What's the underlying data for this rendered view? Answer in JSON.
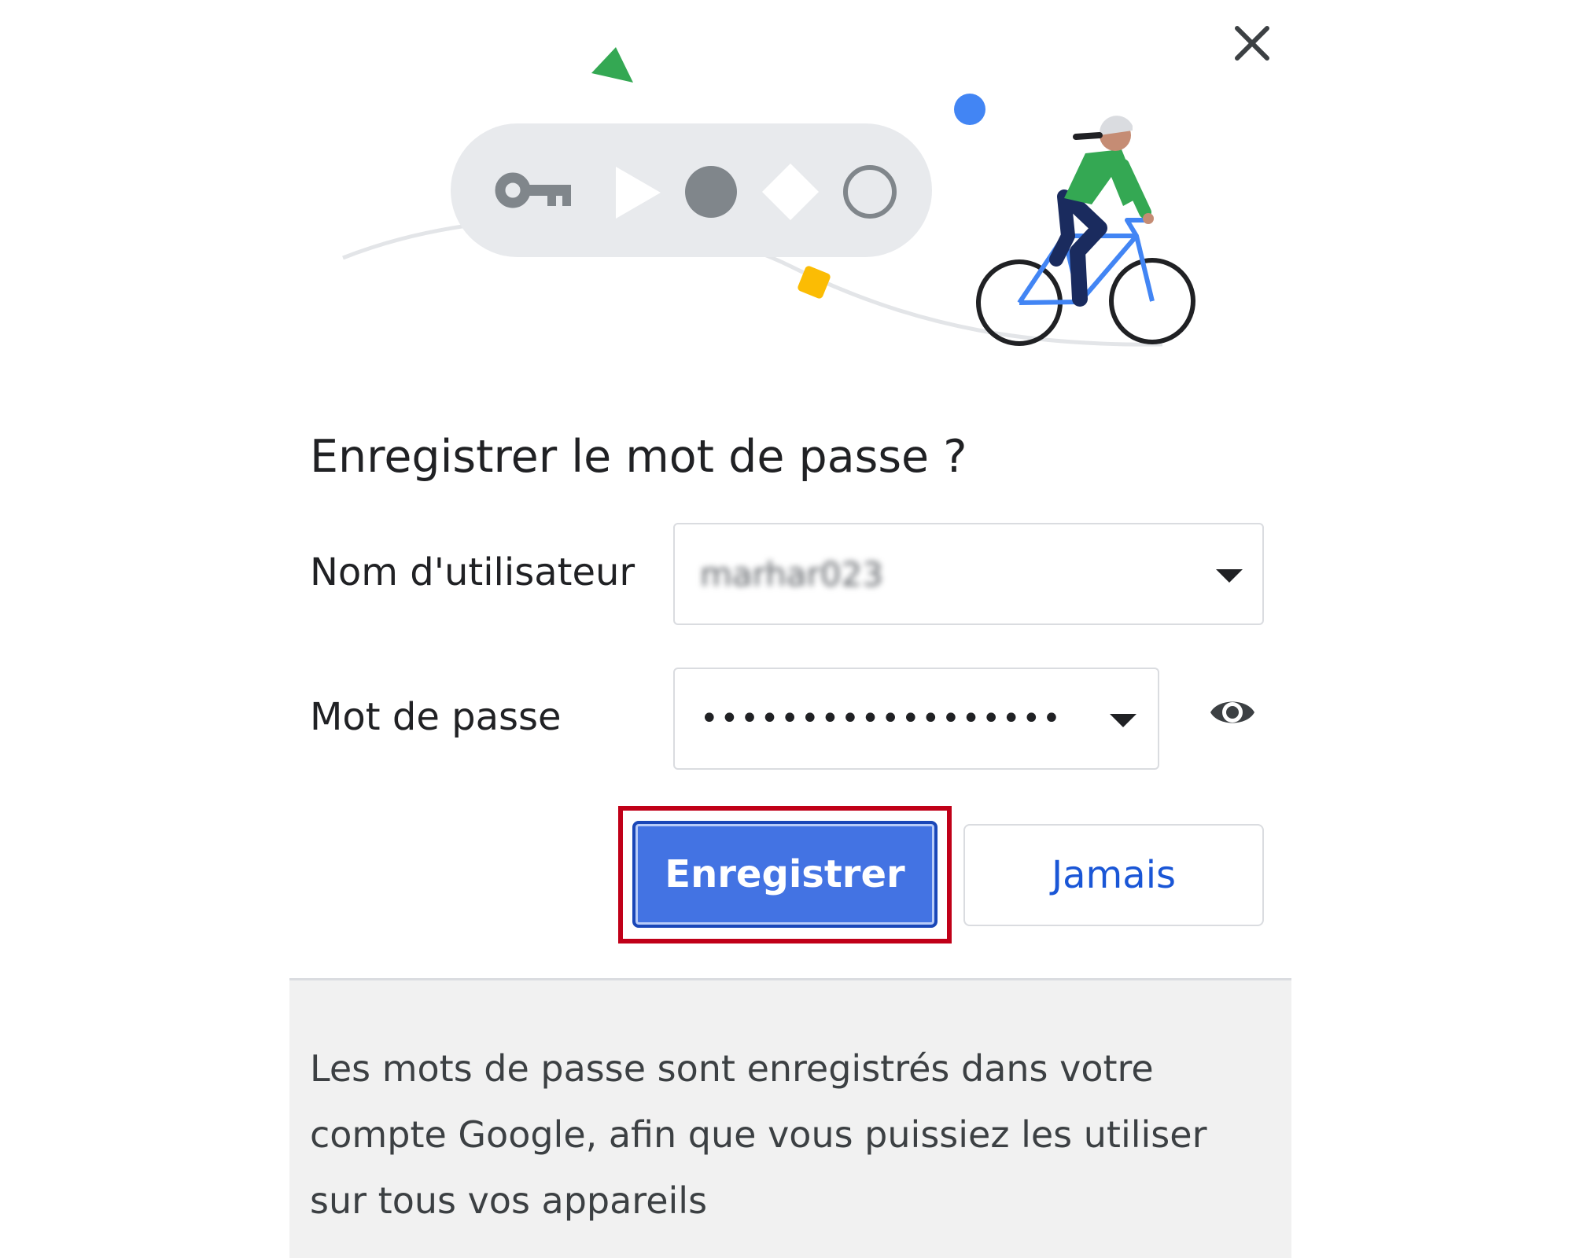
{
  "dialog": {
    "title": "Enregistrer le mot de passe ?",
    "close_icon": "close-icon"
  },
  "illustration": {
    "icons": [
      "key-icon",
      "play-icon",
      "circle-icon",
      "diamond-icon",
      "circle-outline-icon"
    ],
    "figure": "cyclist-illustration",
    "colors": {
      "pill": "#e8eaed",
      "green": "#34a853",
      "blue": "#4285f4",
      "yellow": "#fbbc04",
      "icon_gray": "#80868b"
    }
  },
  "form": {
    "username_label": "Nom d'utilisateur",
    "username_value": "marhar023",
    "password_label": "Mot de passe",
    "password_value": "••••••••••••••••••",
    "show_password_icon": "eye-icon"
  },
  "actions": {
    "save_label": "Enregistrer",
    "never_label": "Jamais"
  },
  "footer": {
    "text": "Les mots de passe sont enregistrés dans votre compte Google, afin que vous puissiez les utiliser sur tous vos appareils"
  },
  "colors": {
    "primary": "#4373e3",
    "link": "#1a56d6",
    "highlight": "#c00018",
    "footer_bg": "#f1f1f1"
  }
}
